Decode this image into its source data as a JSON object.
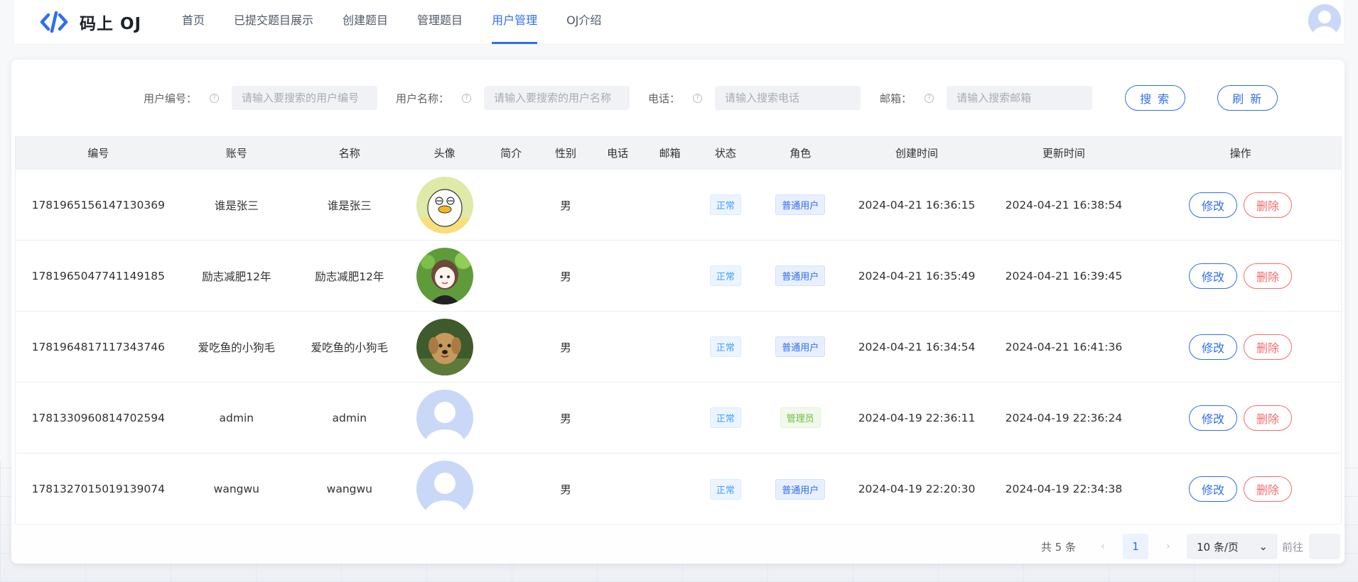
{
  "brand": {
    "name": "码上 OJ",
    "accent": "#2f6fed"
  },
  "nav": {
    "items": [
      {
        "label": "首页",
        "active": false
      },
      {
        "label": "已提交题目展示",
        "active": false
      },
      {
        "label": "创建题目",
        "active": false
      },
      {
        "label": "管理题目",
        "active": false
      },
      {
        "label": "用户管理",
        "active": true
      },
      {
        "label": "OJ介绍",
        "active": false
      }
    ]
  },
  "search": {
    "fields": [
      {
        "label": "用户编号：",
        "placeholder": "请输入要搜索的用户编号"
      },
      {
        "label": "用户名称：",
        "placeholder": "请输入要搜索的用户名称"
      },
      {
        "label": "电话：",
        "placeholder": "请输入搜索电话"
      },
      {
        "label": "邮箱：",
        "placeholder": "请输入搜索邮箱"
      }
    ],
    "search_label": "搜 索",
    "refresh_label": "刷 新",
    "help_icon": "?"
  },
  "table": {
    "headers": [
      "编号",
      "账号",
      "名称",
      "头像",
      "简介",
      "性别",
      "电话",
      "邮箱",
      "状态",
      "角色",
      "创建时间",
      "更新时间",
      "操作"
    ],
    "rows": [
      {
        "id": "1781965156147130369",
        "account": "谁是张三",
        "name": "谁是张三",
        "avatar": "duck-avatar",
        "intro": "",
        "gender": "男",
        "phone": "",
        "email": "",
        "status": "正常",
        "role": "普通用户",
        "role_type": "user",
        "created": "2024-04-21 16:36:15",
        "updated": "2024-04-21 16:38:54"
      },
      {
        "id": "1781965047741149185",
        "account": "励志减肥12年",
        "name": "励志减肥12年",
        "avatar": "girl-avatar",
        "intro": "",
        "gender": "男",
        "phone": "",
        "email": "",
        "status": "正常",
        "role": "普通用户",
        "role_type": "user",
        "created": "2024-04-21 16:35:49",
        "updated": "2024-04-21 16:39:45"
      },
      {
        "id": "1781964817117343746",
        "account": "爱吃鱼的小狗毛",
        "name": "爱吃鱼的小狗毛",
        "avatar": "dog-avatar",
        "intro": "",
        "gender": "男",
        "phone": "",
        "email": "",
        "status": "正常",
        "role": "普通用户",
        "role_type": "user",
        "created": "2024-04-21 16:34:54",
        "updated": "2024-04-21 16:41:36"
      },
      {
        "id": "1781330960814702594",
        "account": "admin",
        "name": "admin",
        "avatar": "default-avatar",
        "intro": "",
        "gender": "男",
        "phone": "",
        "email": "",
        "status": "正常",
        "role": "管理员",
        "role_type": "admin",
        "created": "2024-04-19 22:36:11",
        "updated": "2024-04-19 22:36:24"
      },
      {
        "id": "1781327015019139074",
        "account": "wangwu",
        "name": "wangwu",
        "avatar": "default-avatar",
        "intro": "",
        "gender": "男",
        "phone": "",
        "email": "",
        "status": "正常",
        "role": "普通用户",
        "role_type": "user",
        "created": "2024-04-19 22:20:30",
        "updated": "2024-04-19 22:34:38"
      }
    ],
    "edit_label": "修改",
    "delete_label": "删除"
  },
  "pagination": {
    "total": "共 5 条",
    "current_page": "1",
    "page_size": "10 条/页",
    "goto": "前往",
    "prev_icon": "‹",
    "next_icon": "›",
    "dropdown_icon": "⌄"
  }
}
